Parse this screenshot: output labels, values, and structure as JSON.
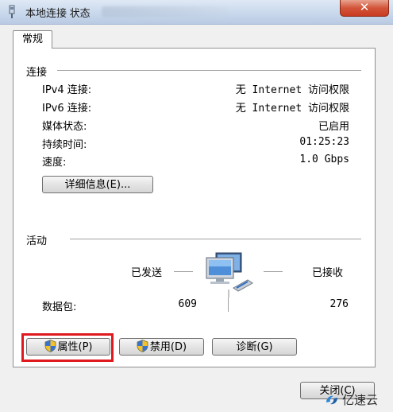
{
  "window": {
    "title": "本地连接 状态",
    "close_label": "✕"
  },
  "tabs": [
    {
      "label": "常规"
    }
  ],
  "connection": {
    "section_title": "连接",
    "rows": [
      {
        "label": "IPv4 连接:",
        "value": "无 Internet 访问权限"
      },
      {
        "label": "IPv6 连接:",
        "value": "无 Internet 访问权限"
      },
      {
        "label": "媒体状态:",
        "value": "已启用"
      },
      {
        "label": "持续时间:",
        "value": "01:25:23"
      },
      {
        "label": "速度:",
        "value": "1.0 Gbps"
      }
    ],
    "details_button": "详细信息(E)..."
  },
  "activity": {
    "section_title": "活动",
    "sent_label": "已发送",
    "received_label": "已接收",
    "packets_label": "数据包:",
    "packets_sent": "609",
    "packets_received": "276",
    "icon": "network-computers-icon"
  },
  "buttons": {
    "properties": "属性(P)",
    "disable": "禁用(D)",
    "diagnose": "诊断(G)",
    "close": "关闭(C)"
  },
  "watermark": {
    "text": "亿速云"
  },
  "colors": {
    "highlight": "#e0191e",
    "close_button": "#c73b22"
  }
}
